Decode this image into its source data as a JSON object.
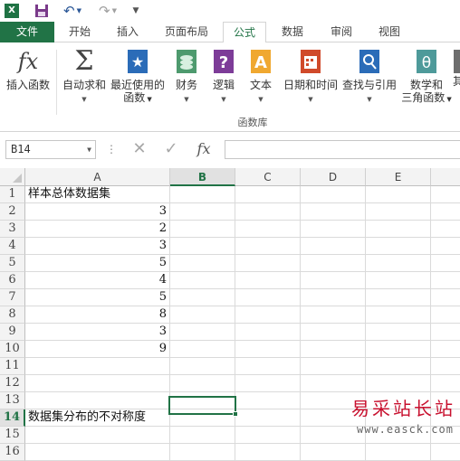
{
  "qat": {
    "logo": "X",
    "save_icon": "save-icon",
    "undo_icon": "undo-icon",
    "redo_icon": "redo-icon"
  },
  "tabs": [
    {
      "label": "文件"
    },
    {
      "label": "开始"
    },
    {
      "label": "插入"
    },
    {
      "label": "页面布局"
    },
    {
      "label": "公式",
      "active": true
    },
    {
      "label": "数据"
    },
    {
      "label": "审阅"
    },
    {
      "label": "视图"
    }
  ],
  "ribbon": {
    "group_label": "函数库",
    "buttons": [
      {
        "line1": "插入函数",
        "line2": "",
        "icon": "fx-icon"
      },
      {
        "line1": "自动求和",
        "line2": "",
        "icon": "sigma-icon"
      },
      {
        "line1": "最近使用的",
        "line2": "函数",
        "icon": "star-book-icon"
      },
      {
        "line1": "财务",
        "line2": "",
        "icon": "coins-book-icon"
      },
      {
        "line1": "逻辑",
        "line2": "",
        "icon": "question-book-icon"
      },
      {
        "line1": "文本",
        "line2": "",
        "icon": "text-book-icon"
      },
      {
        "line1": "日期和时间",
        "line2": "",
        "icon": "calendar-book-icon"
      },
      {
        "line1": "查找与引用",
        "line2": "",
        "icon": "search-book-icon"
      },
      {
        "line1": "数学和",
        "line2": "三角函数",
        "icon": "theta-book-icon"
      },
      {
        "line1": "其",
        "line2": "",
        "icon": "more-book-icon"
      }
    ]
  },
  "formula_bar": {
    "name_box": "B14",
    "cancel": "✕",
    "enter": "✓",
    "fx": "fx",
    "content": ""
  },
  "sheet": {
    "columns": [
      "A",
      "B",
      "C",
      "D",
      "E"
    ],
    "selected_column": "B",
    "selected_row": 14,
    "rows": [
      {
        "n": "1",
        "a": "样本总体数据集",
        "a_type": "txt"
      },
      {
        "n": "2",
        "a": "3",
        "a_type": "num"
      },
      {
        "n": "3",
        "a": "2",
        "a_type": "num"
      },
      {
        "n": "4",
        "a": "3",
        "a_type": "num"
      },
      {
        "n": "5",
        "a": "5",
        "a_type": "num"
      },
      {
        "n": "6",
        "a": "4",
        "a_type": "num"
      },
      {
        "n": "7",
        "a": "5",
        "a_type": "num"
      },
      {
        "n": "8",
        "a": "8",
        "a_type": "num"
      },
      {
        "n": "9",
        "a": "3",
        "a_type": "num"
      },
      {
        "n": "10",
        "a": "9",
        "a_type": "num"
      },
      {
        "n": "11",
        "a": "",
        "a_type": "txt"
      },
      {
        "n": "12",
        "a": "",
        "a_type": "txt"
      },
      {
        "n": "13",
        "a": "",
        "a_type": "txt"
      },
      {
        "n": "14",
        "a": "数据集分布的不对称度",
        "a_type": "txt"
      },
      {
        "n": "15",
        "a": "",
        "a_type": "txt"
      },
      {
        "n": "16",
        "a": "",
        "a_type": "txt"
      }
    ]
  },
  "watermark": {
    "cn": "易采站长站",
    "url": "www.easck.com"
  }
}
